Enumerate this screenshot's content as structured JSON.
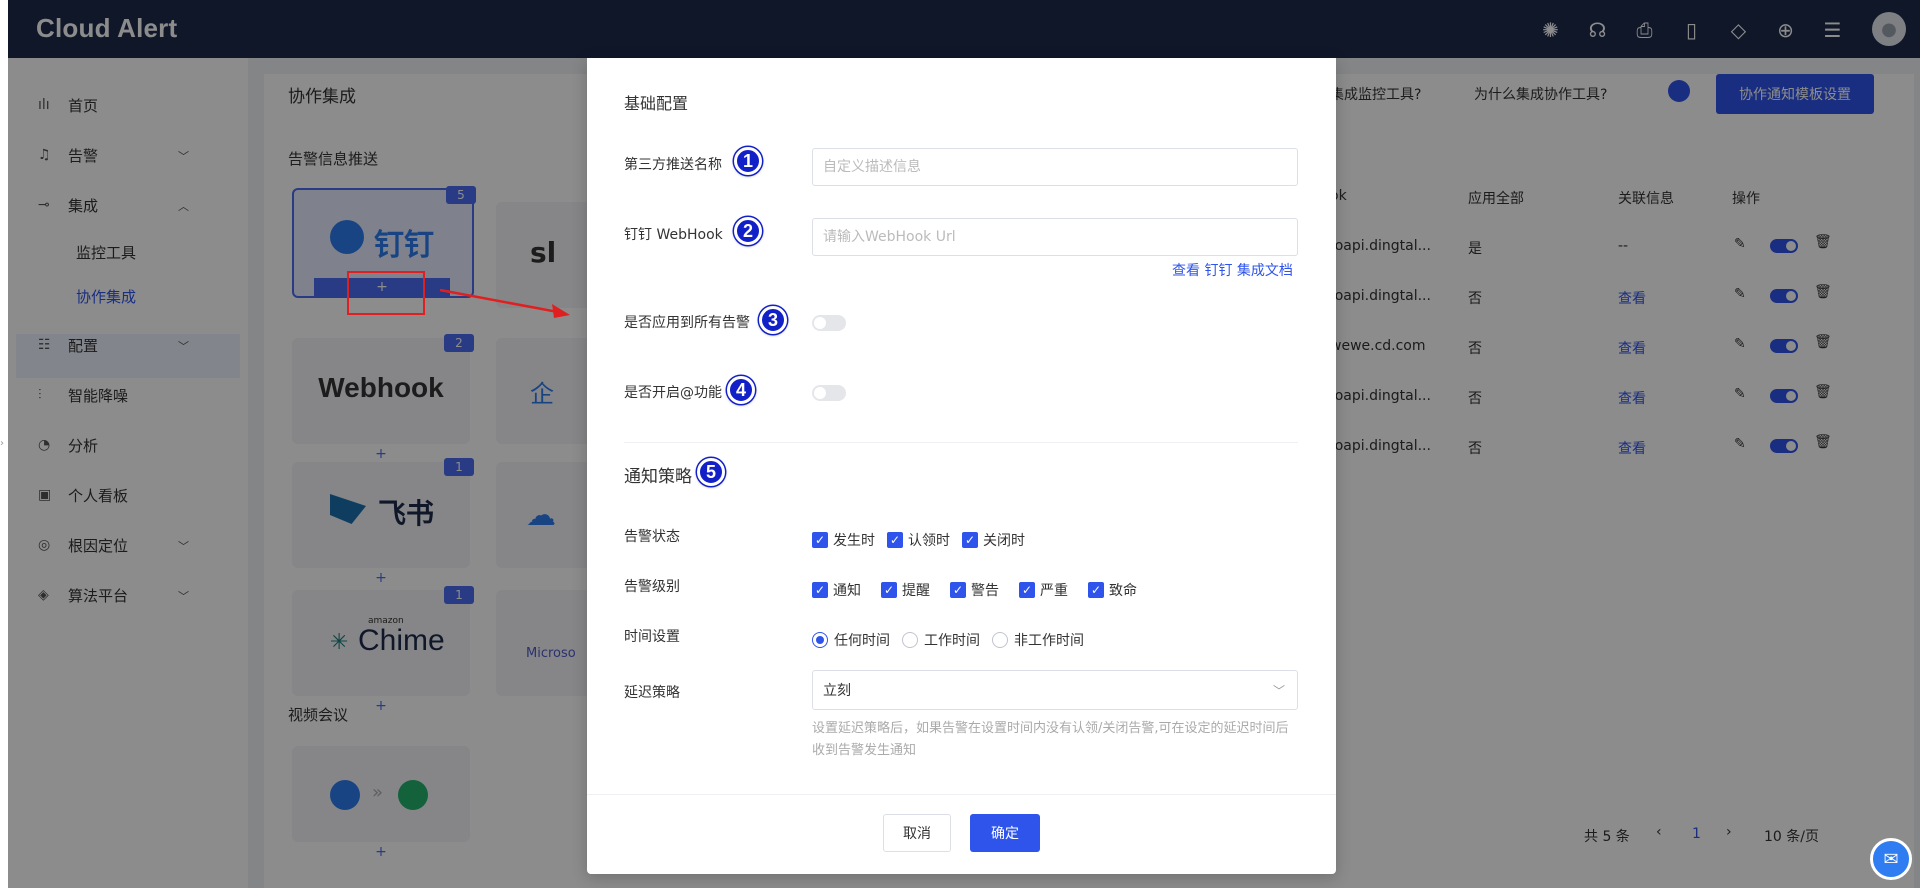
{
  "app": {
    "brand": "Cloud Alert"
  },
  "topbar_icons": [
    "openai-icon",
    "headset-icon",
    "inbox-icon",
    "book-icon",
    "diamond-icon",
    "language-icon",
    "settings-sliders-icon"
  ],
  "sidebar": {
    "items": [
      {
        "label": "首页",
        "icon": "chart-icon"
      },
      {
        "label": "告警",
        "icon": "bell-icon",
        "chevron": "down"
      },
      {
        "label": "集成",
        "icon": "plug-icon",
        "chevron": "up"
      },
      {
        "label": "配置",
        "icon": "sliders-icon",
        "chevron": "down"
      },
      {
        "label": "智能降噪",
        "icon": "wave-icon"
      },
      {
        "label": "分析",
        "icon": "pie-icon"
      },
      {
        "label": "个人看板",
        "icon": "board-icon"
      },
      {
        "label": "根因定位",
        "icon": "target-icon",
        "chevron": "down"
      },
      {
        "label": "算法平台",
        "icon": "layers-icon",
        "chevron": "down"
      }
    ],
    "sub_items": [
      "监控工具",
      "协作集成"
    ]
  },
  "page": {
    "title": "协作集成",
    "header_links": [
      "集成监控工具?",
      "为什么集成协作工具?"
    ],
    "template_button": "协作通知模板设置",
    "section_push": "告警信息推送",
    "section_video": "视频会议"
  },
  "cards": [
    {
      "name": "钉钉",
      "badge": "5"
    },
    {
      "name": "Webhook",
      "badge": "2"
    },
    {
      "name": "飞书",
      "badge": "1"
    },
    {
      "name": "Chime",
      "brand_prefix": "amazon",
      "badge": "1"
    }
  ],
  "partial_cards": [
    "sl",
    "企",
    "",
    "Microso"
  ],
  "table": {
    "headers": [
      "ok",
      "应用全部",
      "关联信息",
      "操作"
    ],
    "rows": [
      {
        "hook": "/oapi.dingtal...",
        "all": "是",
        "info": "--"
      },
      {
        "hook": "/oapi.dingtal...",
        "all": "否",
        "info": "查看"
      },
      {
        "hook": "wewe.cd.com",
        "all": "否",
        "info": "查看"
      },
      {
        "hook": "/oapi.dingtal...",
        "all": "否",
        "info": "查看"
      },
      {
        "hook": "/oapi.dingtal...",
        "all": "否",
        "info": "查看"
      }
    ],
    "pagination": {
      "total": "共 5 条",
      "page": "1",
      "page_size": "10 条/页"
    }
  },
  "modal": {
    "section_basic": "基础配置",
    "name_label": "第三方推送名称",
    "name_placeholder": "自定义描述信息",
    "webhook_label": "钉钉 WebHook",
    "webhook_placeholder": "请输入WebHook Url",
    "doc_link": "查看 钉钉 集成文档",
    "apply_all_label": "是否应用到所有告警",
    "at_label": "是否开启@功能",
    "apply_all_on": false,
    "at_on": false,
    "section_policy": "通知策略",
    "alert_status_label": "告警状态",
    "alert_status_options": [
      "发生时",
      "认领时",
      "关闭时"
    ],
    "alert_level_label": "告警级别",
    "alert_level_options": [
      "通知",
      "提醒",
      "警告",
      "严重",
      "致命"
    ],
    "time_label": "时间设置",
    "time_options": [
      "任何时间",
      "工作时间",
      "非工作时间"
    ],
    "time_selected": "任何时间",
    "delay_label": "延迟策略",
    "delay_value": "立刻",
    "delay_hint": "设置延迟策略后，如果告警在设置时间内没有认领/关闭告警,可在设定的延迟时间后收到告警发生通知",
    "cancel": "取消",
    "ok": "确定"
  },
  "annotations": [
    "1",
    "2",
    "3",
    "4",
    "5"
  ],
  "colors": {
    "primary": "#2f54eb",
    "topbar": "#1d2a4c",
    "annotation_red": "#e02020",
    "marker_blue": "#1220c8"
  }
}
